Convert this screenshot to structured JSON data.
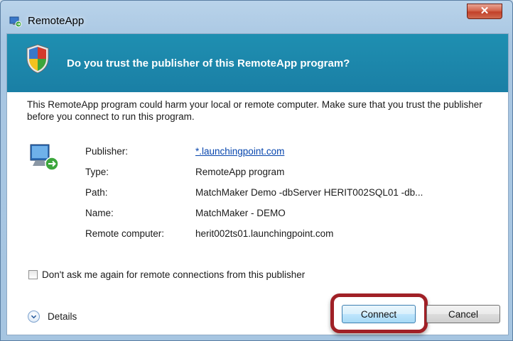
{
  "window": {
    "title": "RemoteApp",
    "close_glyph": "✕",
    "app_icon": "remoteapp-icon"
  },
  "banner": {
    "icon": "security-shield-icon",
    "text": "Do you trust the publisher of this RemoteApp program?",
    "color": "#1f8fb1"
  },
  "message": "This RemoteApp program could harm your local or remote computer. Make sure that you trust the publisher before you connect to run this program.",
  "details_icon": "remote-computer-icon",
  "info": [
    {
      "label": "Publisher:",
      "value": "*.launchingpoint.com",
      "link": true
    },
    {
      "label": "Type:",
      "value": "RemoteApp program"
    },
    {
      "label": "Path:",
      "value": "MatchMaker Demo -dbServer HERIT002SQL01 -db..."
    },
    {
      "label": "Name:",
      "value": "MatchMaker - DEMO"
    },
    {
      "label": "Remote computer:",
      "value": "herit002ts01.launchingpoint.com"
    }
  ],
  "checkbox": {
    "label": "Don't ask me again for remote connections from this publisher",
    "checked": false
  },
  "details": {
    "label": "Details",
    "icon": "chevron-down-icon"
  },
  "buttons": {
    "connect": "Connect",
    "cancel": "Cancel"
  },
  "highlight_color": "#a02026"
}
